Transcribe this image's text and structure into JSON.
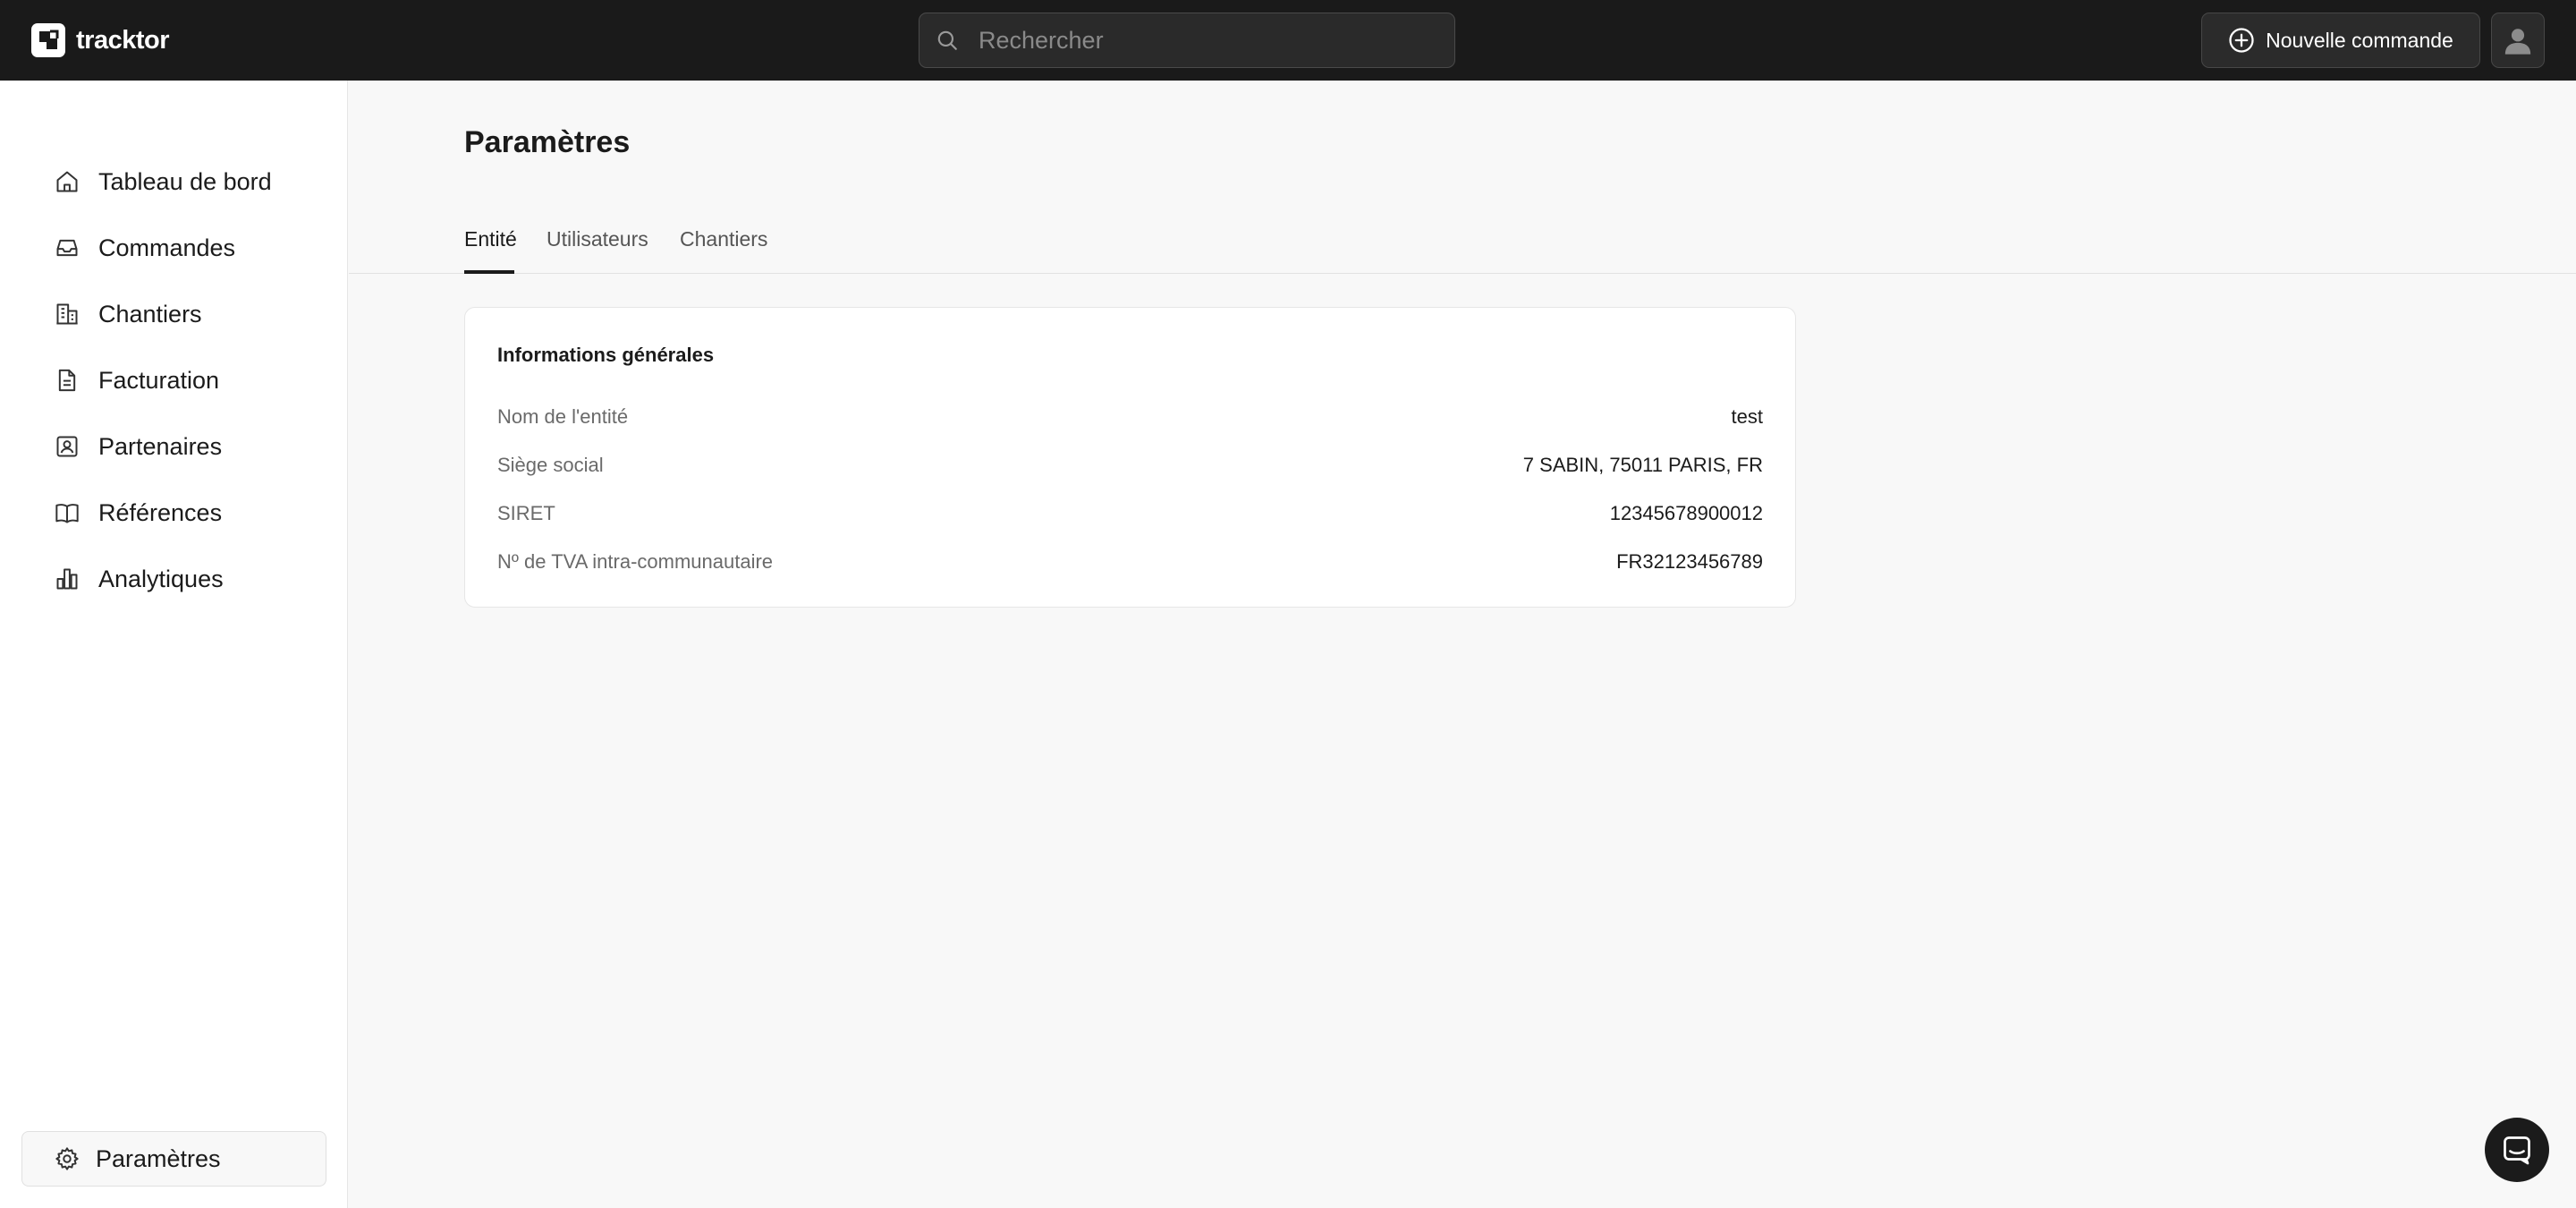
{
  "app": {
    "name": "tracktor"
  },
  "header": {
    "search_placeholder": "Rechercher",
    "new_order_label": "Nouvelle commande"
  },
  "sidebar": {
    "items": [
      {
        "label": "Tableau de bord",
        "icon": "home-icon"
      },
      {
        "label": "Commandes",
        "icon": "inbox-icon"
      },
      {
        "label": "Chantiers",
        "icon": "building-icon"
      },
      {
        "label": "Facturation",
        "icon": "document-icon"
      },
      {
        "label": "Partenaires",
        "icon": "contact-card-icon"
      },
      {
        "label": "Références",
        "icon": "book-icon"
      },
      {
        "label": "Analytiques",
        "icon": "bar-chart-icon"
      }
    ],
    "settings_label": "Paramètres"
  },
  "main": {
    "title": "Paramètres",
    "tabs": [
      {
        "label": "Entité",
        "active": true
      },
      {
        "label": "Utilisateurs",
        "active": false
      },
      {
        "label": "Chantiers",
        "active": false
      }
    ],
    "card": {
      "title": "Informations générales",
      "rows": [
        {
          "label": "Nom de l'entité",
          "value": "test"
        },
        {
          "label": "Siège social",
          "value": "7 SABIN, 75011 PARIS, FR"
        },
        {
          "label": "SIRET",
          "value": "12345678900012"
        },
        {
          "label": "Nº de TVA intra-communautaire",
          "value": "FR32123456789"
        }
      ]
    }
  },
  "colors": {
    "topbar": "#1a1a1a",
    "background": "#f8f8f8",
    "card": "#ffffff",
    "text": "#1b1b1b",
    "muted": "#6a6a6a"
  }
}
